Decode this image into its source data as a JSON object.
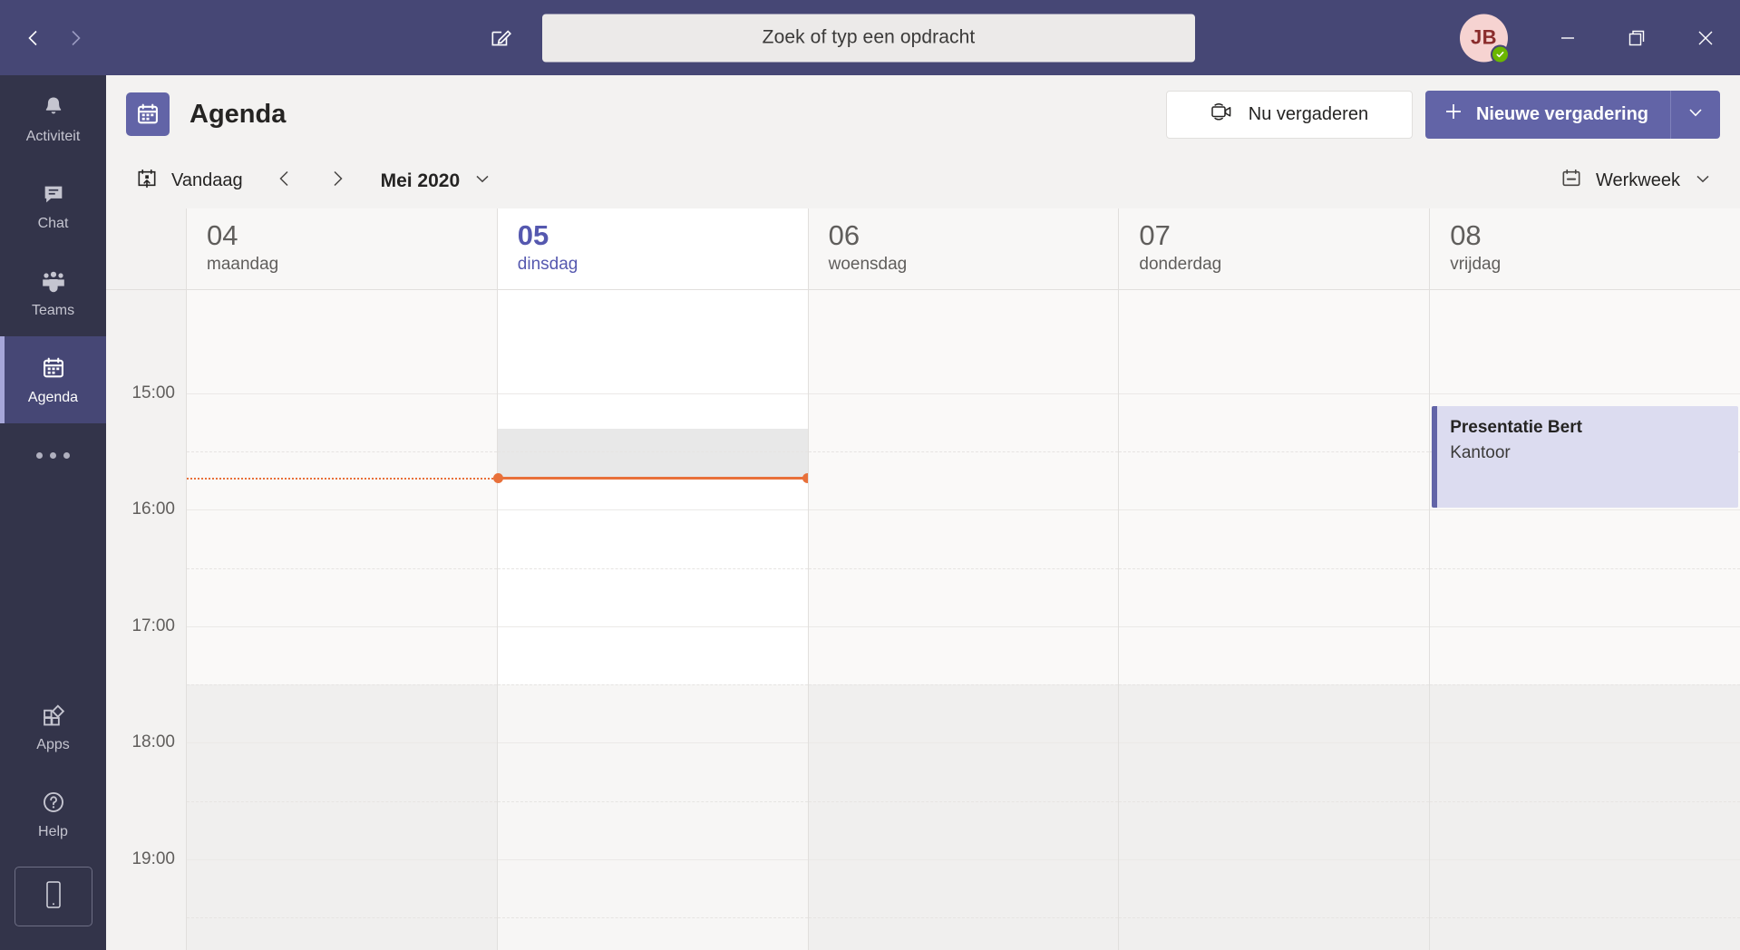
{
  "titlebar": {
    "back_icon": "chevron-left-icon",
    "forward_icon": "chevron-right-icon",
    "compose_icon": "compose-edit-icon",
    "search_placeholder": "Zoek of typ een opdracht",
    "avatar_initials": "JB",
    "presence_status": "available",
    "minimize_label": "—",
    "maximize_label": "restore",
    "close_label": "✕",
    "bg_color": "#464775"
  },
  "rail": {
    "items": [
      {
        "label": "Activiteit",
        "icon": "bell-icon",
        "active": false
      },
      {
        "label": "Chat",
        "icon": "chat-bubble-icon",
        "active": false
      },
      {
        "label": "Teams",
        "icon": "people-icon",
        "active": false
      },
      {
        "label": "Agenda",
        "icon": "calendar-icon",
        "active": true
      }
    ],
    "more_icon": "more-dots-icon",
    "bottom": [
      {
        "label": "Apps",
        "icon": "apps-icon"
      },
      {
        "label": "Help",
        "icon": "question-circle-icon"
      }
    ],
    "mobile_icon": "mobile-phone-icon",
    "bg_color": "#33344a",
    "active_color": "#464775"
  },
  "apphead": {
    "icon": "calendar-icon",
    "title": "Agenda",
    "meet_now_label": "Nu vergaderen",
    "meet_now_icon": "video-camera-icon",
    "new_meeting_label": "Nieuwe vergadering",
    "new_meeting_icon": "plus-icon",
    "new_meeting_caret_icon": "chevron-down-icon",
    "accent_color": "#6264a7"
  },
  "toolbar": {
    "today_label": "Vandaag",
    "today_icon": "today-calendar-icon",
    "prev_icon": "chevron-left-icon",
    "next_icon": "chevron-right-icon",
    "month_label": "Mei 2020",
    "month_caret_icon": "chevron-down-icon",
    "view_label": "Werkweek",
    "view_icon": "calendar-week-icon",
    "view_caret_icon": "chevron-down-icon"
  },
  "calendar": {
    "days": [
      {
        "num": "04",
        "name": "maandag",
        "today": false
      },
      {
        "num": "05",
        "name": "dinsdag",
        "today": true
      },
      {
        "num": "06",
        "name": "woensdag",
        "today": false
      },
      {
        "num": "07",
        "name": "donderdag",
        "today": false
      },
      {
        "num": "08",
        "name": "vrijdag",
        "today": false
      }
    ],
    "hours": [
      "15:00",
      "16:00",
      "17:00",
      "18:00",
      "19:00"
    ],
    "now_indicator": {
      "time": "15:52",
      "color": "#e8703a",
      "day_index": 1
    },
    "offhours_start": "17:30",
    "events": [
      {
        "title": "Presentatie Bert",
        "location": "Kantoor",
        "day_index": 4,
        "start": "15:10",
        "end": "16:00",
        "accent_color": "#6264a7",
        "bg_color": "#dcdcf0"
      }
    ]
  }
}
